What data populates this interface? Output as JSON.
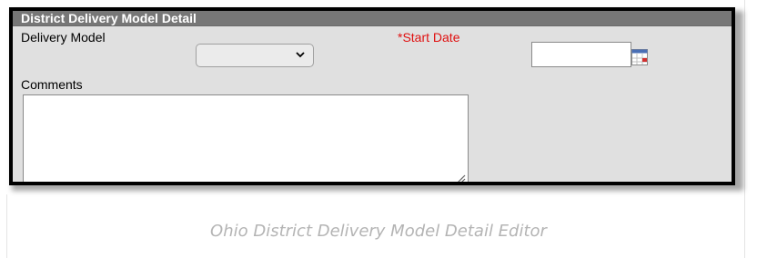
{
  "panel": {
    "title": "District Delivery Model Detail"
  },
  "form": {
    "delivery_model_label": "Delivery Model",
    "delivery_model_value": "",
    "start_date_label": "*Start Date",
    "start_date_value": "",
    "comments_label": "Comments",
    "comments_value": ""
  },
  "icons": {
    "dropdown": "chevron-down-icon",
    "date_picker": "calendar-icon",
    "resize": "resize-grip-icon"
  },
  "colors": {
    "header_bg": "#777777",
    "panel_bg": "#e0e0e0",
    "required_label": "#e01010"
  },
  "caption": "Ohio District Delivery Model Detail Editor"
}
